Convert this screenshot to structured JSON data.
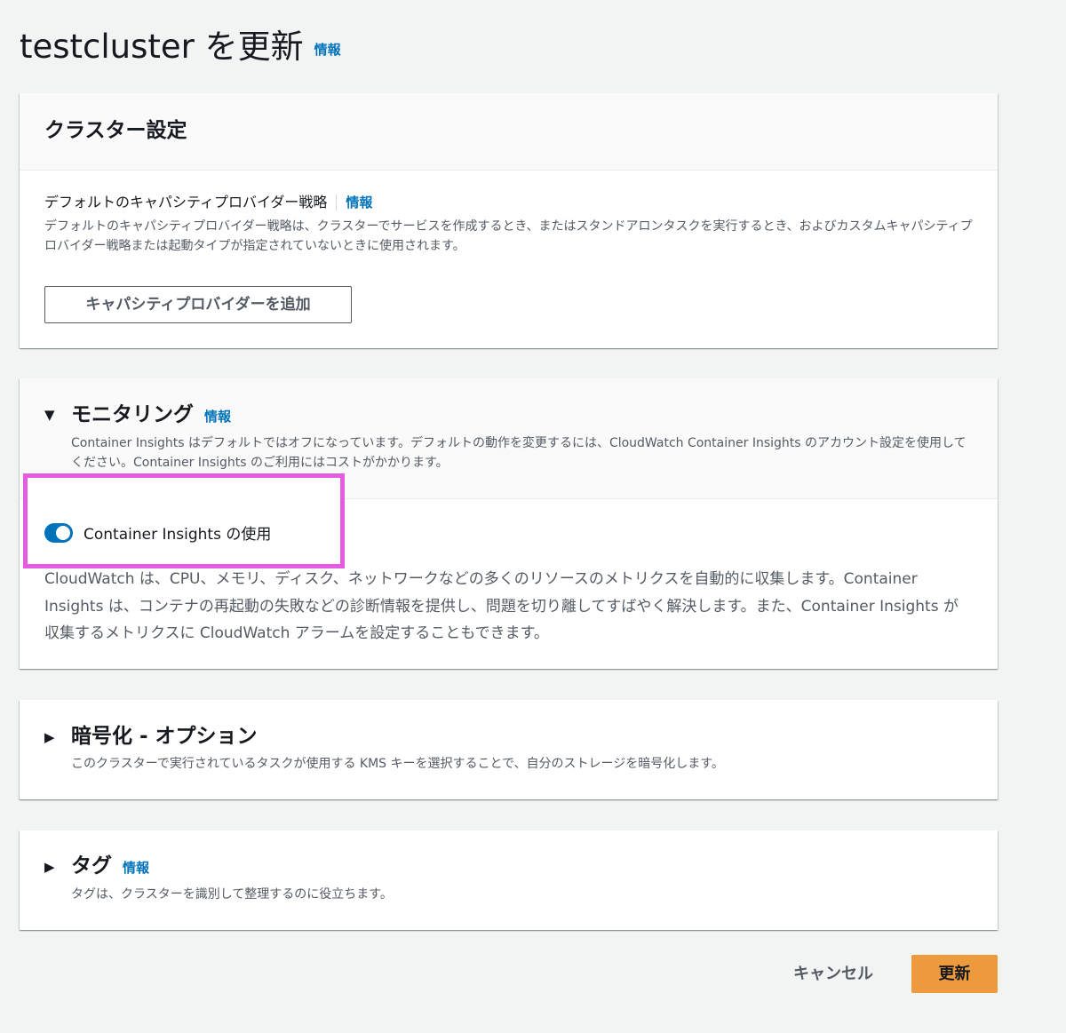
{
  "page": {
    "title": "testcluster を更新",
    "info_link": "情報"
  },
  "cluster_settings": {
    "title": "クラスター設定",
    "capacity_label": "デフォルトのキャパシティプロバイダー戦略",
    "capacity_info_link": "情報",
    "capacity_description": "デフォルトのキャパシティプロバイダー戦略は、クラスターでサービスを作成するとき、またはスタンドアロンタスクを実行するとき、およびカスタムキャパシティプロバイダー戦略または起動タイプが指定されていないときに使用されます。",
    "add_provider_button": "キャパシティプロバイダーを追加"
  },
  "monitoring": {
    "title": "モニタリング",
    "info_link": "情報",
    "description": "Container Insights はデフォルトではオフになっています。デフォルトの動作を変更するには、CloudWatch Container Insights のアカウント設定を使用してください。Container Insights のご利用にはコストがかかります。",
    "toggle_label": "Container Insights の使用",
    "toggle_on": true,
    "body": "CloudWatch は、CPU、メモリ、ディスク、ネットワークなどの多くのリソースのメトリクスを自動的に収集します。Container Insights は、コンテナの再起動の失敗などの診断情報を提供し、問題を切り離してすばやく解決します。また、Container Insights が収集するメトリクスに CloudWatch アラームを設定することもできます。"
  },
  "encryption": {
    "title": "暗号化 - オプション",
    "description": "このクラスターで実行されているタスクが使用する KMS キーを選択することで、自分のストレージを暗号化します。"
  },
  "tags": {
    "title": "タグ",
    "info_link": "情報",
    "description": "タグは、クラスターを識別して整理するのに役立ちます。"
  },
  "footer": {
    "cancel_label": "キャンセル",
    "update_label": "更新"
  },
  "colors": {
    "background": "#f2f3f3",
    "link": "#0073bb",
    "primary_button": "#ec9a3c",
    "toggle_on": "#0073bb",
    "highlight_annotation": "#e65ce0"
  },
  "icons": {
    "expanded": "caret-down-icon",
    "collapsed": "caret-right-icon"
  }
}
